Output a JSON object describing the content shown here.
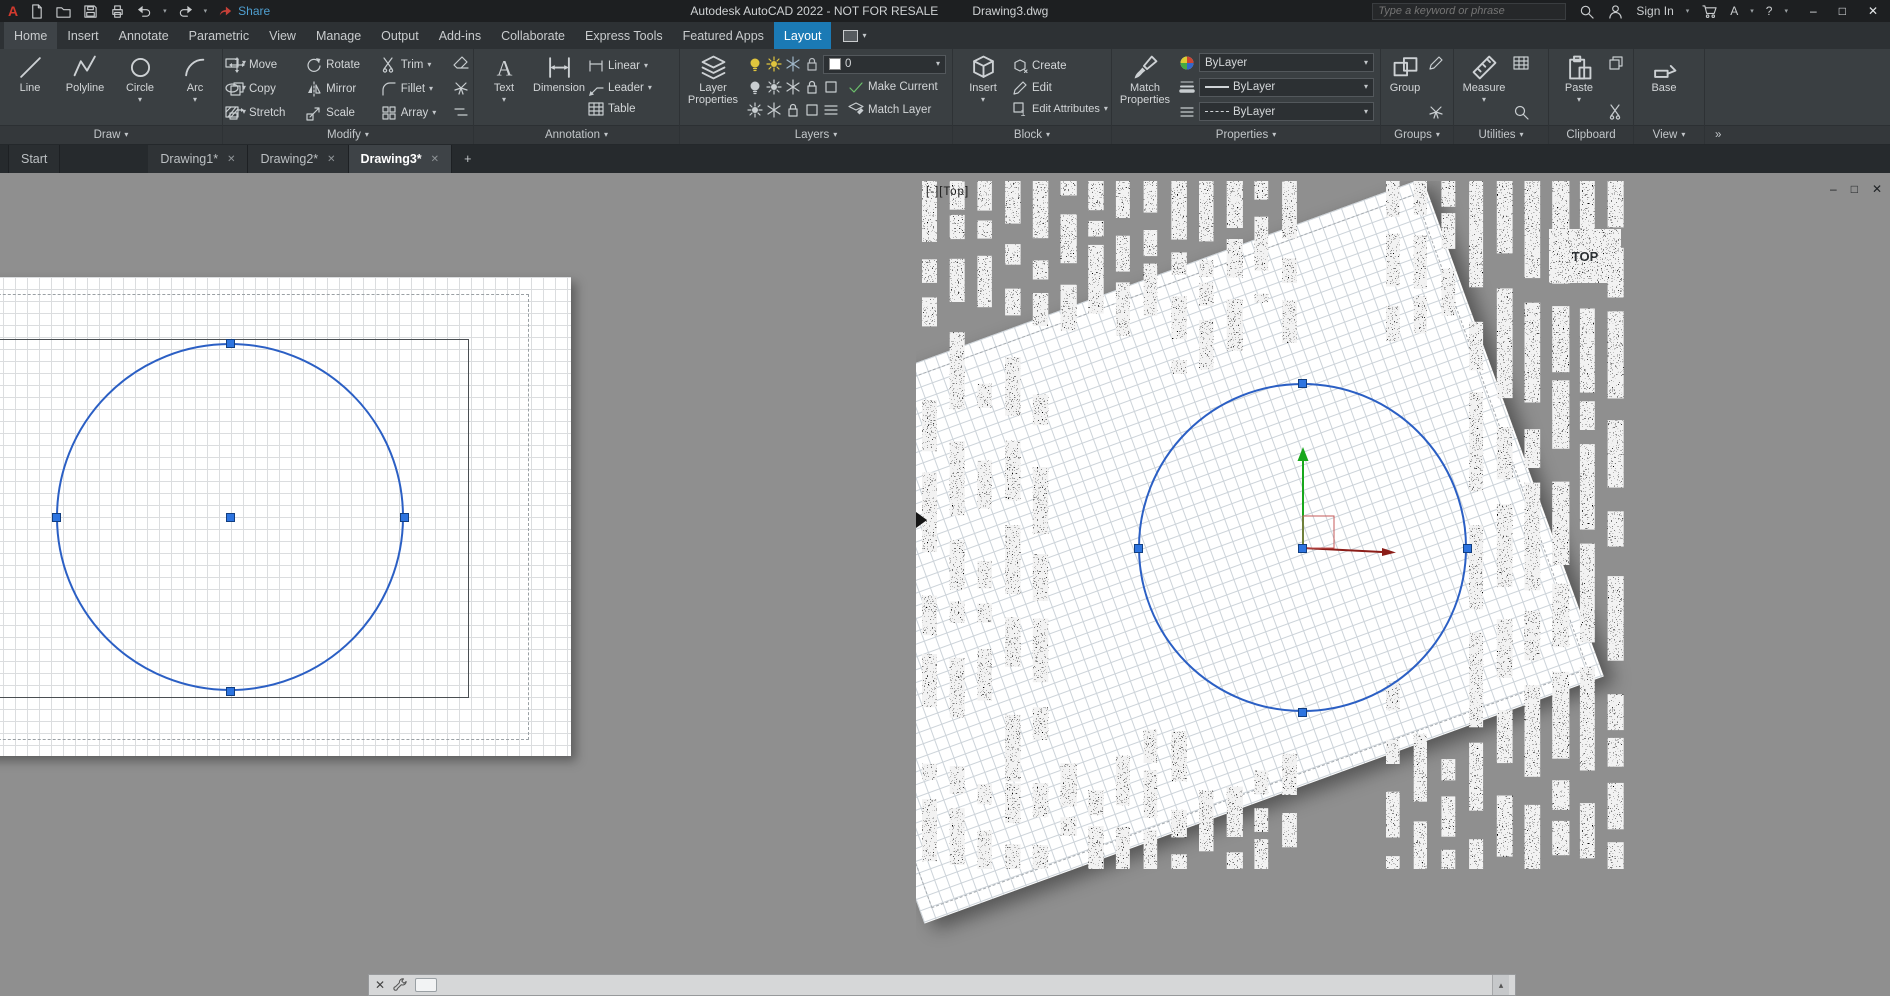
{
  "icons_text": {
    "chevron": "▾",
    "close": "✕",
    "plus": "+",
    "overflow": "»",
    "up_arrow": "▴",
    "window_min": "–",
    "window_max": "□",
    "window_restore": "□"
  },
  "titlebar": {
    "share_label": "Share",
    "title": "Autodesk AutoCAD 2022 - NOT FOR RESALE",
    "filename": "Drawing3.dwg",
    "search_placeholder": "Type a keyword or phrase",
    "sign_in_label": "Sign In",
    "apps_label": "A",
    "help_label": "?"
  },
  "ribbon_tabs": [
    "Home",
    "Insert",
    "Annotate",
    "Parametric",
    "View",
    "Manage",
    "Output",
    "Add-ins",
    "Collaborate",
    "Express Tools",
    "Featured Apps",
    "Layout"
  ],
  "ribbon": {
    "draw": {
      "label": "Draw",
      "line": "Line",
      "polyline": "Polyline",
      "circle": "Circle",
      "arc": "Arc"
    },
    "modify": {
      "label": "Modify",
      "items": [
        "Move",
        "Rotate",
        "Trim",
        "Copy",
        "Mirror",
        "Fillet",
        "Stretch",
        "Scale",
        "Array"
      ]
    },
    "annotation": {
      "label": "Annotation",
      "text": "Text",
      "dimension": "Dimension",
      "side": [
        "Linear",
        "Leader",
        "Table"
      ]
    },
    "layers": {
      "label": "Layers",
      "layer_properties": "Layer Properties",
      "current_layer": "0",
      "make_current": "Make Current",
      "match_layer": "Match Layer"
    },
    "block": {
      "label": "Block",
      "insert": "Insert",
      "create": "Create",
      "edit": "Edit",
      "edit_attributes": "Edit Attributes"
    },
    "properties": {
      "label": "Properties",
      "match_properties": "Match Properties",
      "color": "ByLayer",
      "lineweight": "ByLayer",
      "linetype": "ByLayer"
    },
    "groups": {
      "label": "Groups",
      "group": "Group"
    },
    "utilities": {
      "label": "Utilities",
      "measure": "Measure"
    },
    "clipboard": {
      "label": "Clipboard",
      "paste": "Paste"
    },
    "view": {
      "label": "View",
      "base": "Base"
    }
  },
  "doc_tabs": {
    "start": "Start",
    "drawing1": "Drawing1*",
    "drawing2": "Drawing2*",
    "drawing3": "Drawing3*"
  },
  "viewport": {
    "controls": "[-][Top]",
    "viewcube": "TOP"
  },
  "colors": {
    "active_tab_blue": "#1b7ab5",
    "canvas_gray": "#8f8f8f",
    "paper_white": "#ffffff",
    "selection_blue": "#2b5fc4",
    "grip_blue": "#2d74e0",
    "ucs_green": "#18a71c",
    "ucs_red": "#8c1d18"
  }
}
